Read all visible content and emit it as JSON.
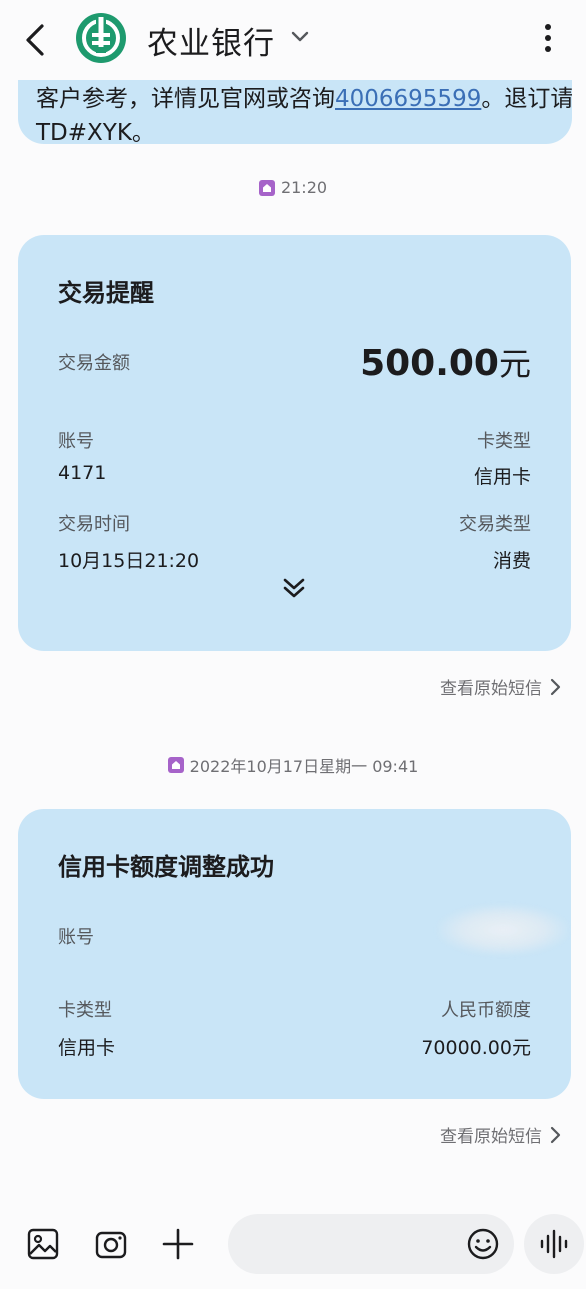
{
  "header": {
    "sender_name": "农业银行",
    "icons": {
      "back": "chevron-left-icon",
      "logo": "abc-bank-logo",
      "dropdown": "chevron-down-icon",
      "more": "more-vertical-icon"
    }
  },
  "prev_message": {
    "line1_pre": "客户参考，详情见官网或咨询",
    "phone": "4006695599",
    "line1_post": "。退订请回",
    "line2": "TD#XYK。"
  },
  "messages": [
    {
      "time": "21:20",
      "card": {
        "title": "交易提醒",
        "amount_label": "交易金额",
        "amount_value": "500.00",
        "amount_unit": "元",
        "account_label": "账号",
        "account_value": "4171",
        "card_type_label": "卡类型",
        "card_type_value": "信用卡",
        "time_label": "交易时间",
        "time_value": "10月15日21:20",
        "tx_type_label": "交易类型",
        "tx_type_value": "消费"
      },
      "view_original": "查看原始短信"
    },
    {
      "time": "2022年10月17日星期一 09:41",
      "card": {
        "title": "信用卡额度调整成功",
        "account_label": "账号",
        "card_type_label": "卡类型",
        "card_type_value": "信用卡",
        "limit_label": "人民币额度",
        "limit_value": "70000.00元"
      },
      "view_original": "查看原始短信"
    }
  ],
  "bottom_bar": {
    "icons": [
      "gallery-icon",
      "camera-icon",
      "plus-icon",
      "emoji-icon",
      "voice-icon"
    ]
  },
  "colors": {
    "bubble": "#c9e5f7",
    "link": "#3b6fb6",
    "sim_badge": "#a663c9",
    "logo": "#1e9a6e"
  }
}
